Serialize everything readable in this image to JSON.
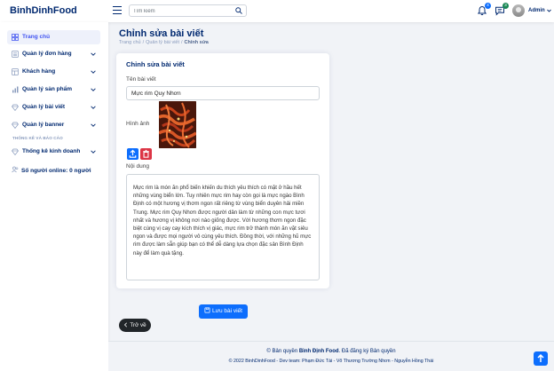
{
  "header": {
    "logo": "BinhDinhFood",
    "search_placeholder": "Tìm kiếm",
    "notifications_count": "4",
    "messages_count": "3",
    "user_name": "Admin",
    "colors": {
      "primary": "#012970",
      "accent": "#4154f1",
      "notif_badge": "#0d6efd",
      "msg_badge": "#198754"
    }
  },
  "sidebar": {
    "items": [
      {
        "label": "Trang chủ",
        "icon": "grid-icon"
      },
      {
        "label": "Quản lý đơn hàng",
        "icon": "menu-icon"
      },
      {
        "label": "Khách hàng",
        "icon": "layout-icon"
      },
      {
        "label": "Quản lý sản phẩm",
        "icon": "bar-chart-icon"
      },
      {
        "label": "Quản lý bài viết",
        "icon": "gem-icon"
      },
      {
        "label": "Quản lý banner",
        "icon": "gem-icon"
      }
    ],
    "section_heading": "THỐNG KÊ VÀ BÁO CÁO",
    "stats_item": {
      "label": "Thống kê kinh doanh",
      "icon": "gem-icon"
    },
    "online_label": "Số người online:",
    "online_count": "0 người"
  },
  "page": {
    "title": "Chỉnh sửa bài viết",
    "breadcrumb": [
      "Trang chủ",
      "Quản lý bài viết",
      "Chỉnh sửa"
    ]
  },
  "form": {
    "card_title": "Chỉnh sửa bài viết",
    "name_label": "Tên bài viết",
    "name_value": "Mực rim Quy Nhơn",
    "image_label": "Hình ảnh",
    "content_label": "Nội dung",
    "content": "Mực rim là món ăn phổ biến khiến du thích yêu thích có mặt ở hầu hết những vùng biển lớn. Tuy nhiên mực rim hay còn gọi là mực ngào Bình Định có một hương vị thơm ngon rất riêng từ vùng biển duyên hải miền Trung. Mực rim Quy Nhơn được người dân làm từ những con mực tươi nhất và hương vị không nơi nào giống được. Với hương thơm ngon đặc biệt cùng vị cay cay kích thích vị giác, mực rim trở thành món ăn vặt siêu ngon và được mọi người vô cùng yêu thích. Đồng thời, với những hũ mực rim được làm sẵn giúp bạn có thể dễ dàng lựa chọn đặc sản Bình Định này để làm quà tặng.",
    "save_label": "Lưu bài viết",
    "back_label": "Trở về"
  },
  "footer": {
    "copyright_prefix": "© Bản quyền",
    "brand": "Bình Định Food",
    "copyright_suffix": ". Đã đăng ký Bản quyền",
    "dev_line": "© 2022 BinhDinhFood - Dev team: Phạm Đức Tài - Võ Thương Trường Nhơn - Nguyễn Hồng Thái"
  }
}
